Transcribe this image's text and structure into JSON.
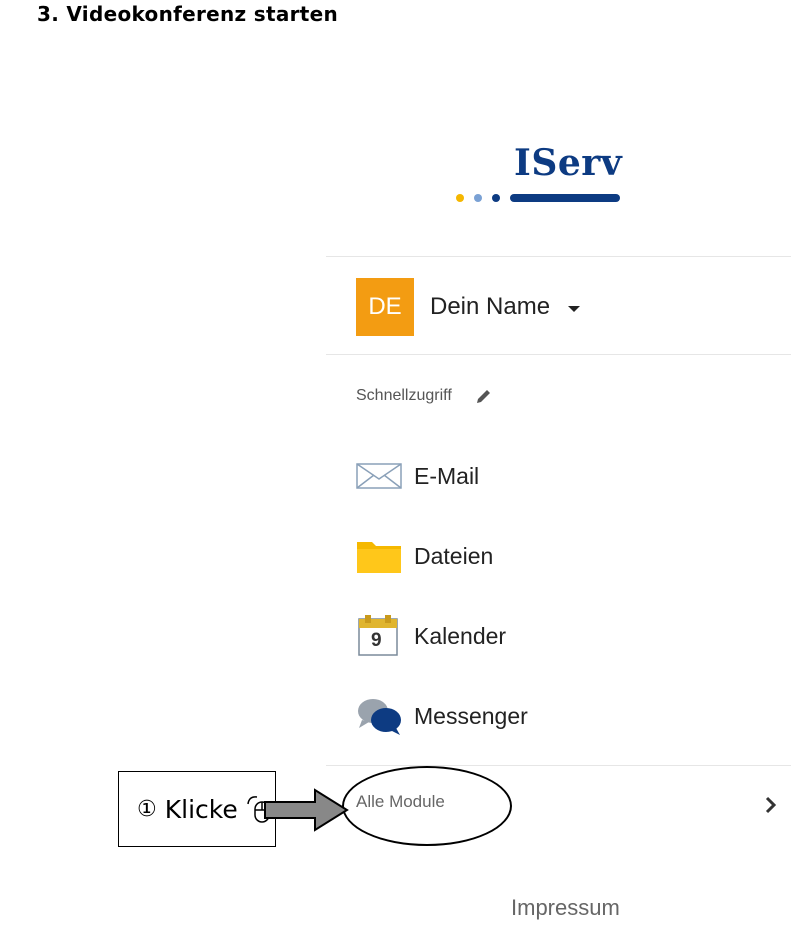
{
  "heading": "3. Videokonferenz starten",
  "logo": {
    "text": "IServ",
    "dot_colors": [
      "#f5b700",
      "#7aa1d4",
      "#0d3b82"
    ],
    "brand_color": "#0d3b82"
  },
  "user": {
    "initials": "DE",
    "name": "Dein Name",
    "avatar_color": "#f39c12"
  },
  "quick_access": {
    "label": "Schnellzugriff"
  },
  "nav": [
    {
      "label": "E-Mail",
      "icon": "envelope-icon"
    },
    {
      "label": "Dateien",
      "icon": "folder-icon"
    },
    {
      "label": "Kalender",
      "icon": "calendar-icon",
      "calendar_day": "9"
    },
    {
      "label": "Messenger",
      "icon": "chat-bubbles-icon"
    }
  ],
  "all_modules": {
    "label": "Alle Module"
  },
  "callout": {
    "number": "①",
    "text": "Klicke"
  },
  "footer": {
    "impressum": "Impressum"
  }
}
